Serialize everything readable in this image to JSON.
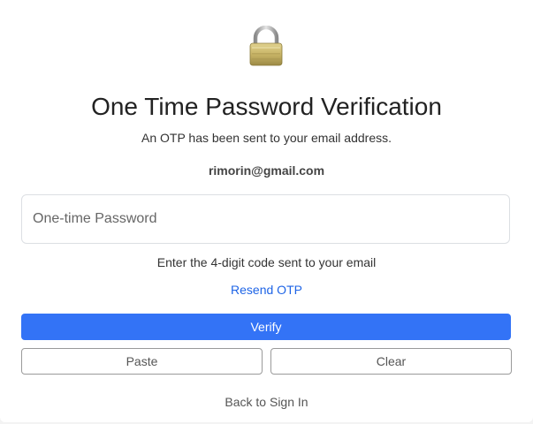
{
  "header": {
    "icon": "lock-icon",
    "title": "One Time Password Verification",
    "subtitle": "An OTP has been sent to your email address.",
    "email": "rimorin@gmail.com"
  },
  "form": {
    "otp_value": "",
    "otp_placeholder": "One-time Password",
    "hint": "Enter the 4-digit code sent to your email",
    "resend_label": "Resend OTP"
  },
  "actions": {
    "verify_label": "Verify",
    "paste_label": "Paste",
    "clear_label": "Clear",
    "back_label": "Back to Sign In"
  },
  "colors": {
    "primary": "#3373f6",
    "link": "#1e64e6",
    "lock_body": "#c9b56a",
    "lock_shackle": "#a8a8a8"
  }
}
